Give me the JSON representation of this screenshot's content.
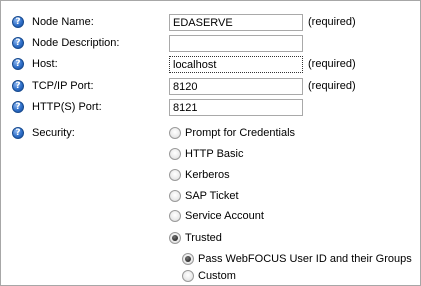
{
  "fields": [
    {
      "label": "Node Name:",
      "value": "EDASERVE",
      "required": "(required)"
    },
    {
      "label": "Node Description:",
      "value": "",
      "required": ""
    },
    {
      "label": "Host:",
      "value": "localhost",
      "required": "(required)"
    },
    {
      "label": "TCP/IP Port:",
      "value": "8120",
      "required": "(required)"
    },
    {
      "label": "HTTP(S) Port:",
      "value": "8121",
      "required": ""
    }
  ],
  "security": {
    "label": "Security:",
    "options": [
      {
        "label": "Prompt for Credentials",
        "checked": false
      },
      {
        "label": "HTTP Basic",
        "checked": false
      },
      {
        "label": "Kerberos",
        "checked": false
      },
      {
        "label": "SAP Ticket",
        "checked": false
      },
      {
        "label": "Service Account",
        "checked": false
      },
      {
        "label": "Trusted",
        "checked": true
      }
    ],
    "trusted_options": [
      {
        "label": "Pass WebFOCUS User ID and their Groups",
        "checked": true
      },
      {
        "label": "Custom",
        "checked": false
      }
    ]
  },
  "icons": {
    "help": "help-icon"
  },
  "colors": {
    "help_icon": "#2f6fc9",
    "border": "#a7a7a7"
  }
}
